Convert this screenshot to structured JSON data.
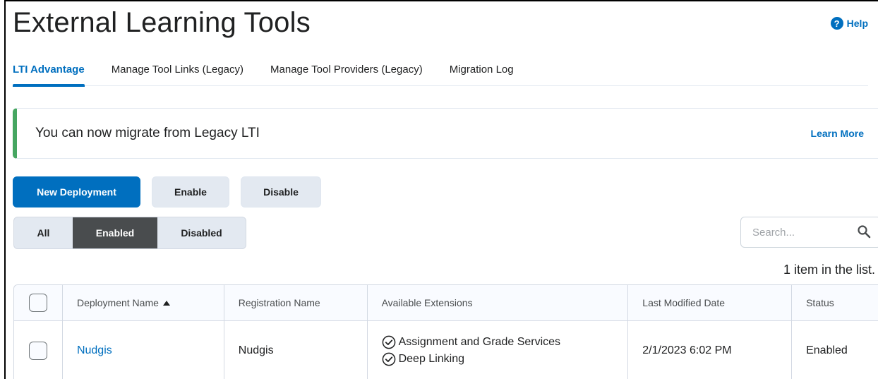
{
  "page": {
    "title": "External Learning Tools",
    "help_label": "Help"
  },
  "tabs": [
    {
      "label": "LTI Advantage",
      "active": true
    },
    {
      "label": "Manage Tool Links (Legacy)",
      "active": false
    },
    {
      "label": "Manage Tool Providers (Legacy)",
      "active": false
    },
    {
      "label": "Migration Log",
      "active": false
    }
  ],
  "alert": {
    "text": "You can now migrate from Legacy LTI",
    "link_label": "Learn More",
    "accent_color": "#46a661"
  },
  "actions": {
    "new_deployment": "New Deployment",
    "enable": "Enable",
    "disable": "Disable"
  },
  "filter": {
    "all": "All",
    "enabled": "Enabled",
    "disabled": "Disabled",
    "selected": "Enabled"
  },
  "search": {
    "placeholder": "Search..."
  },
  "list_count": "1 item in the list.",
  "table": {
    "columns": [
      "Deployment Name",
      "Registration Name",
      "Available Extensions",
      "Last Modified Date",
      "Status"
    ],
    "rows": [
      {
        "deployment_name": "Nudgis",
        "registration_name": "Nudgis",
        "extensions": [
          "Assignment and Grade Services",
          "Deep Linking"
        ],
        "last_modified": "2/1/2023 6:02 PM",
        "status": "Enabled"
      }
    ]
  },
  "colors": {
    "primary": "#006fbf",
    "selected_filter": "#494c4e"
  }
}
